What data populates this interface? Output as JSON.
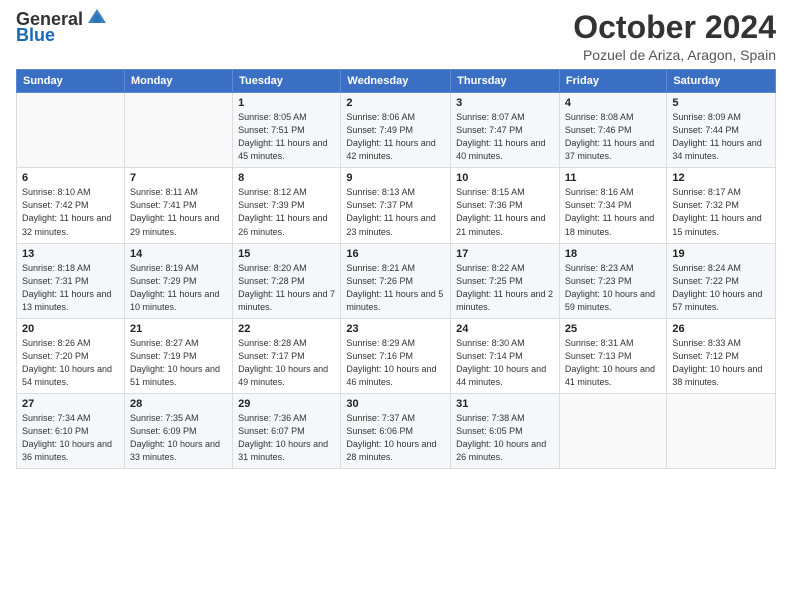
{
  "header": {
    "logo_general": "General",
    "logo_blue": "Blue",
    "title": "October 2024",
    "subtitle": "Pozuel de Ariza, Aragon, Spain"
  },
  "calendar": {
    "days_of_week": [
      "Sunday",
      "Monday",
      "Tuesday",
      "Wednesday",
      "Thursday",
      "Friday",
      "Saturday"
    ],
    "weeks": [
      [
        {
          "day": "",
          "info": ""
        },
        {
          "day": "",
          "info": ""
        },
        {
          "day": "1",
          "info": "Sunrise: 8:05 AM\nSunset: 7:51 PM\nDaylight: 11 hours and 45 minutes."
        },
        {
          "day": "2",
          "info": "Sunrise: 8:06 AM\nSunset: 7:49 PM\nDaylight: 11 hours and 42 minutes."
        },
        {
          "day": "3",
          "info": "Sunrise: 8:07 AM\nSunset: 7:47 PM\nDaylight: 11 hours and 40 minutes."
        },
        {
          "day": "4",
          "info": "Sunrise: 8:08 AM\nSunset: 7:46 PM\nDaylight: 11 hours and 37 minutes."
        },
        {
          "day": "5",
          "info": "Sunrise: 8:09 AM\nSunset: 7:44 PM\nDaylight: 11 hours and 34 minutes."
        }
      ],
      [
        {
          "day": "6",
          "info": "Sunrise: 8:10 AM\nSunset: 7:42 PM\nDaylight: 11 hours and 32 minutes."
        },
        {
          "day": "7",
          "info": "Sunrise: 8:11 AM\nSunset: 7:41 PM\nDaylight: 11 hours and 29 minutes."
        },
        {
          "day": "8",
          "info": "Sunrise: 8:12 AM\nSunset: 7:39 PM\nDaylight: 11 hours and 26 minutes."
        },
        {
          "day": "9",
          "info": "Sunrise: 8:13 AM\nSunset: 7:37 PM\nDaylight: 11 hours and 23 minutes."
        },
        {
          "day": "10",
          "info": "Sunrise: 8:15 AM\nSunset: 7:36 PM\nDaylight: 11 hours and 21 minutes."
        },
        {
          "day": "11",
          "info": "Sunrise: 8:16 AM\nSunset: 7:34 PM\nDaylight: 11 hours and 18 minutes."
        },
        {
          "day": "12",
          "info": "Sunrise: 8:17 AM\nSunset: 7:32 PM\nDaylight: 11 hours and 15 minutes."
        }
      ],
      [
        {
          "day": "13",
          "info": "Sunrise: 8:18 AM\nSunset: 7:31 PM\nDaylight: 11 hours and 13 minutes."
        },
        {
          "day": "14",
          "info": "Sunrise: 8:19 AM\nSunset: 7:29 PM\nDaylight: 11 hours and 10 minutes."
        },
        {
          "day": "15",
          "info": "Sunrise: 8:20 AM\nSunset: 7:28 PM\nDaylight: 11 hours and 7 minutes."
        },
        {
          "day": "16",
          "info": "Sunrise: 8:21 AM\nSunset: 7:26 PM\nDaylight: 11 hours and 5 minutes."
        },
        {
          "day": "17",
          "info": "Sunrise: 8:22 AM\nSunset: 7:25 PM\nDaylight: 11 hours and 2 minutes."
        },
        {
          "day": "18",
          "info": "Sunrise: 8:23 AM\nSunset: 7:23 PM\nDaylight: 10 hours and 59 minutes."
        },
        {
          "day": "19",
          "info": "Sunrise: 8:24 AM\nSunset: 7:22 PM\nDaylight: 10 hours and 57 minutes."
        }
      ],
      [
        {
          "day": "20",
          "info": "Sunrise: 8:26 AM\nSunset: 7:20 PM\nDaylight: 10 hours and 54 minutes."
        },
        {
          "day": "21",
          "info": "Sunrise: 8:27 AM\nSunset: 7:19 PM\nDaylight: 10 hours and 51 minutes."
        },
        {
          "day": "22",
          "info": "Sunrise: 8:28 AM\nSunset: 7:17 PM\nDaylight: 10 hours and 49 minutes."
        },
        {
          "day": "23",
          "info": "Sunrise: 8:29 AM\nSunset: 7:16 PM\nDaylight: 10 hours and 46 minutes."
        },
        {
          "day": "24",
          "info": "Sunrise: 8:30 AM\nSunset: 7:14 PM\nDaylight: 10 hours and 44 minutes."
        },
        {
          "day": "25",
          "info": "Sunrise: 8:31 AM\nSunset: 7:13 PM\nDaylight: 10 hours and 41 minutes."
        },
        {
          "day": "26",
          "info": "Sunrise: 8:33 AM\nSunset: 7:12 PM\nDaylight: 10 hours and 38 minutes."
        }
      ],
      [
        {
          "day": "27",
          "info": "Sunrise: 7:34 AM\nSunset: 6:10 PM\nDaylight: 10 hours and 36 minutes."
        },
        {
          "day": "28",
          "info": "Sunrise: 7:35 AM\nSunset: 6:09 PM\nDaylight: 10 hours and 33 minutes."
        },
        {
          "day": "29",
          "info": "Sunrise: 7:36 AM\nSunset: 6:07 PM\nDaylight: 10 hours and 31 minutes."
        },
        {
          "day": "30",
          "info": "Sunrise: 7:37 AM\nSunset: 6:06 PM\nDaylight: 10 hours and 28 minutes."
        },
        {
          "day": "31",
          "info": "Sunrise: 7:38 AM\nSunset: 6:05 PM\nDaylight: 10 hours and 26 minutes."
        },
        {
          "day": "",
          "info": ""
        },
        {
          "day": "",
          "info": ""
        }
      ]
    ]
  }
}
